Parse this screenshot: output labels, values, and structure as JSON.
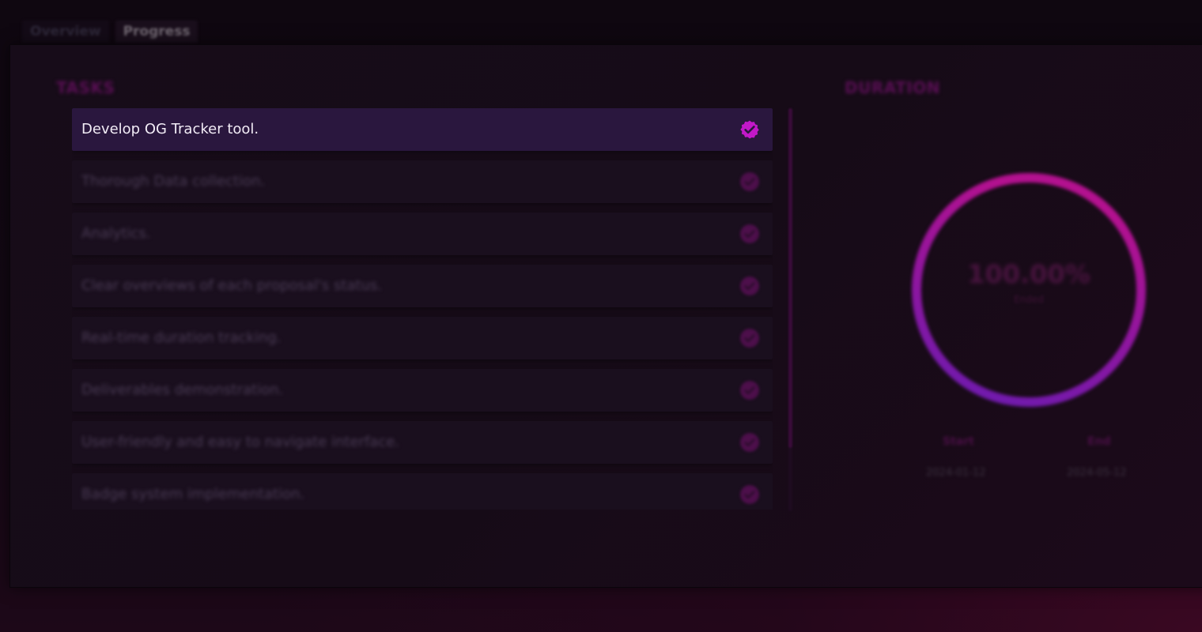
{
  "tabs": [
    {
      "label": "Overview",
      "active": false
    },
    {
      "label": "Progress",
      "active": true
    }
  ],
  "tasks_section": {
    "title": "TASKS",
    "items": [
      {
        "label": "Develop OG Tracker tool.",
        "done": true,
        "highlighted": true
      },
      {
        "label": "Thorough Data collection.",
        "done": true,
        "highlighted": false
      },
      {
        "label": "Analytics.",
        "done": true,
        "highlighted": false
      },
      {
        "label": "Clear overviews of each proposal's status.",
        "done": true,
        "highlighted": false
      },
      {
        "label": "Real-time duration tracking.",
        "done": true,
        "highlighted": false
      },
      {
        "label": "Deliverables demonstration.",
        "done": true,
        "highlighted": false
      },
      {
        "label": "User-friendly and easy to navigate interface.",
        "done": true,
        "highlighted": false
      },
      {
        "label": "Badge system implementation.",
        "done": true,
        "highlighted": false
      }
    ]
  },
  "duration_section": {
    "title": "DURATION",
    "progress_percent": 100,
    "progress_text": "100.00%",
    "progress_caption": "Ended",
    "start_label": "Start",
    "end_label": "End",
    "start_date": "2024-01-12",
    "end_date": "2024-05-12"
  },
  "colors": {
    "accent": "#c218c9",
    "ring_start": "#6a1bb0",
    "ring_end": "#b3118f",
    "highlight_row": "#2a173e"
  },
  "icons": {
    "check": "verified-check-icon"
  }
}
